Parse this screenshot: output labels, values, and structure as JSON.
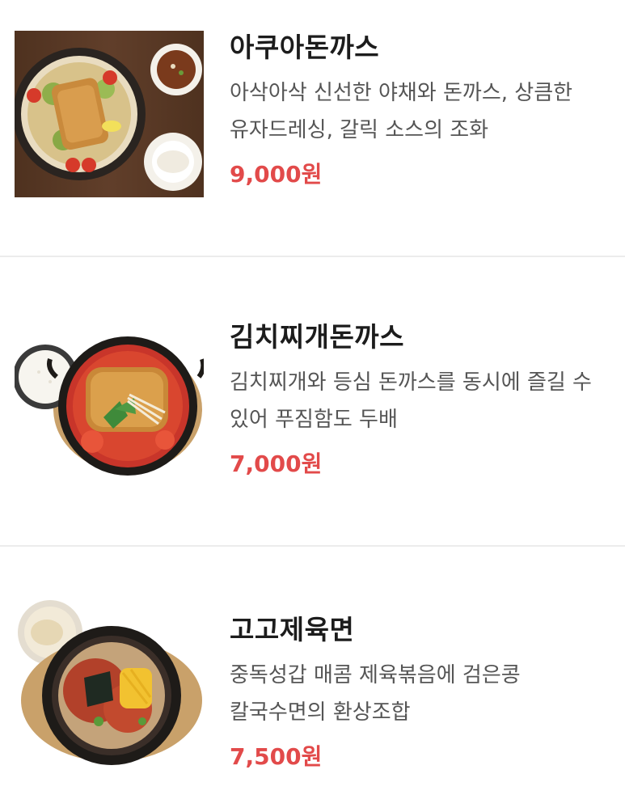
{
  "menu": {
    "items": [
      {
        "name": "아쿠아돈까스",
        "description": "아삭아삭 신선한 야채와 돈까스, 상큼한 유자드레싱, 갈릭 소스의 조화",
        "price": "9,000원"
      },
      {
        "name": "김치찌개돈까스",
        "description": "김치찌개와 등심 돈까스를 동시에 즐길 수 있어 푸짐함도 두배",
        "price": "7,000원"
      },
      {
        "name": "고고제육면",
        "description": "중독성갑 매콤 제육볶음에 검은콩 칼국수면의 환상조합",
        "price": "7,500원"
      }
    ]
  },
  "colors": {
    "price": "#e24a4a",
    "divider": "#ececec",
    "name": "#1c1c1c",
    "description": "#555555"
  }
}
